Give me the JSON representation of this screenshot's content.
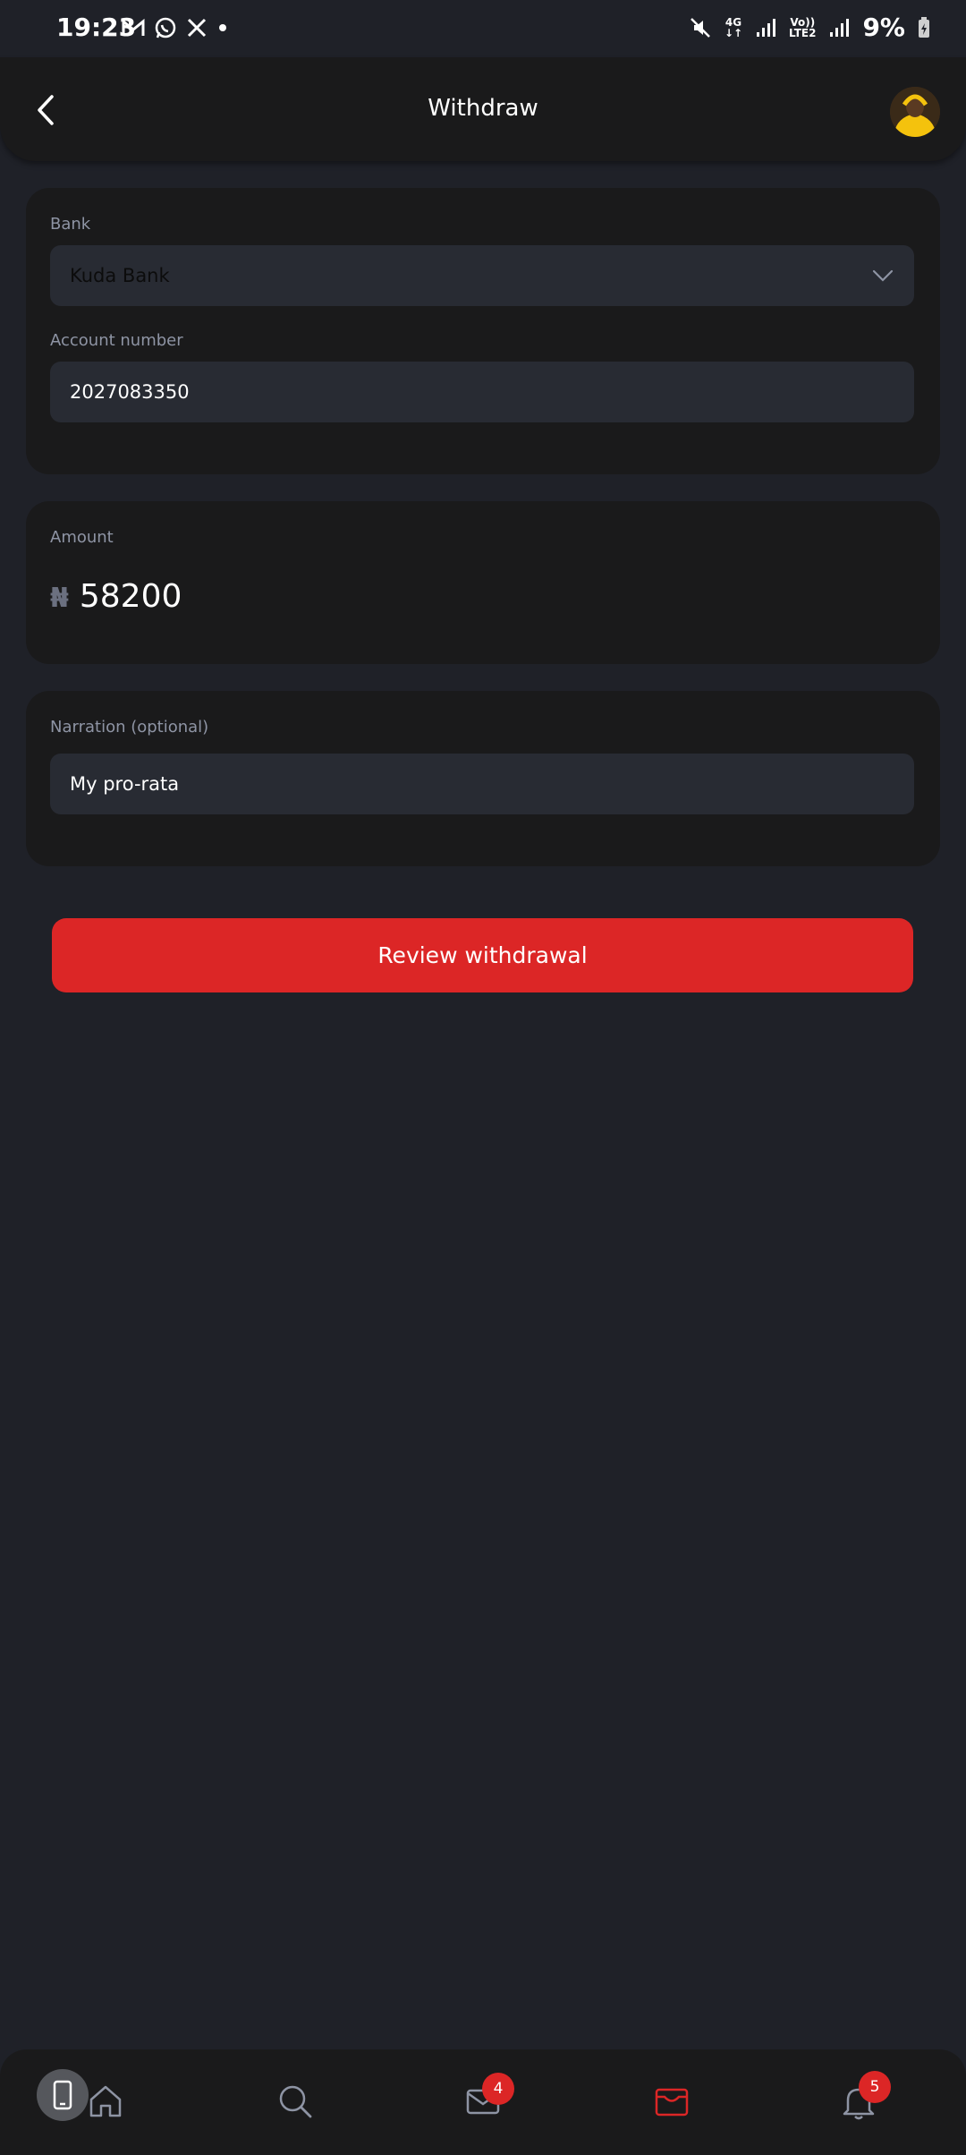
{
  "status_bar": {
    "time": "19:23",
    "net_4g": "4G",
    "volte_top": "Vo))",
    "volte_bottom": "LTE2",
    "battery": "9%"
  },
  "header": {
    "title": "Withdraw"
  },
  "bank_card": {
    "bank_label": "Bank",
    "bank_value": "Kuda Bank",
    "account_label": "Account number",
    "account_value": "2027083350"
  },
  "amount_card": {
    "label": "Amount",
    "currency_symbol": "₦",
    "value": "58200"
  },
  "narration_card": {
    "label": "Narration (optional)",
    "value": "My pro-rata"
  },
  "cta": {
    "label": "Review withdrawal"
  },
  "bottom_nav": {
    "items": [
      {
        "icon": "home-icon"
      },
      {
        "icon": "search-icon"
      },
      {
        "icon": "mail-icon",
        "badge": "4"
      },
      {
        "icon": "wallet-icon",
        "active": true
      },
      {
        "icon": "bell-icon",
        "badge": "5"
      }
    ]
  },
  "colors": {
    "accent": "#dc2626",
    "background": "#1f2128",
    "card": "#1a1a1b",
    "field": "#282b33"
  }
}
